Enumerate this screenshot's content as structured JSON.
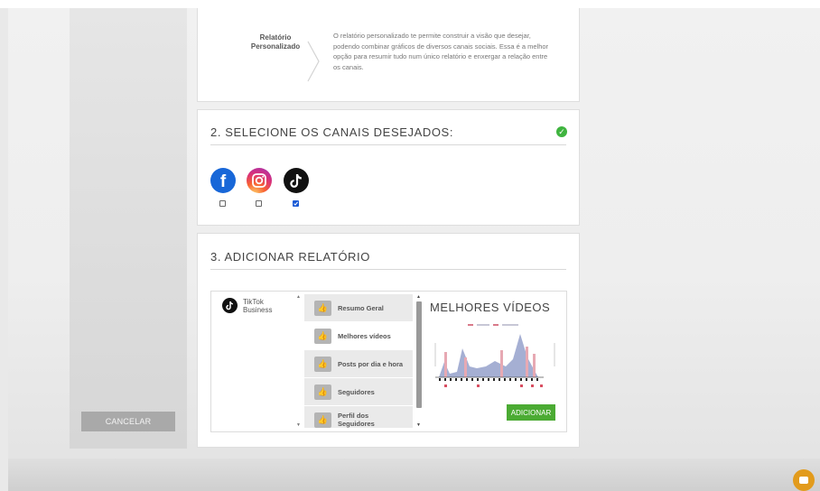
{
  "sidebar": {
    "cancel_label": "CANCELAR"
  },
  "report_type": {
    "label_line1": "Relatório",
    "label_line2": "Personalizado",
    "description": "O relatório personalizado te permite construir a visão que desejar, podendo combinar gráficos de diversos canais sociais. Essa é a melhor opção para resumir tudo num único relatório e enxergar a relação entre os canais."
  },
  "channels_section": {
    "title": "2. SELECIONE OS CANAIS DESEJADOS:",
    "channels": [
      {
        "icon": "facebook-icon",
        "checked": false
      },
      {
        "icon": "instagram-icon",
        "checked": false
      },
      {
        "icon": "tiktok-icon",
        "checked": true
      }
    ]
  },
  "reports_section": {
    "title": "3. ADICIONAR RELATÓRIO",
    "network": {
      "line1": "TikTok",
      "line2": "Business"
    },
    "items": [
      {
        "label": "Resumo Geral"
      },
      {
        "label": "Melhores vídeos"
      },
      {
        "label": "Posts por dia e hora"
      },
      {
        "label": "Seguidores"
      },
      {
        "label": "Perfil dos Seguidores"
      }
    ],
    "selected_index": 1,
    "preview_title": "MELHORES VÍDEOS",
    "add_label": "ADICIONAR"
  },
  "colors": {
    "accent_green": "#4bab33",
    "check_blue": "#1b5bd6",
    "chat_orange": "#e29b1c"
  }
}
